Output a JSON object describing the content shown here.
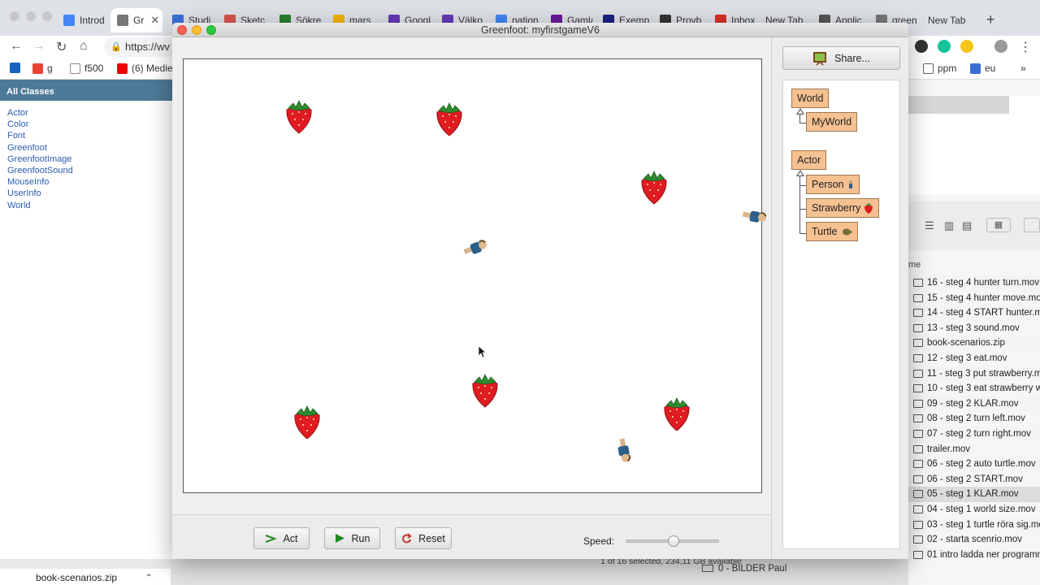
{
  "browser": {
    "tabs": [
      {
        "label": "Introd",
        "color": "#4285f4"
      },
      {
        "label": "Gr",
        "color": "#777777",
        "active": true
      },
      {
        "label": "Studi",
        "color": "#3b6fd6"
      },
      {
        "label": "Sketc",
        "color": "#d9534f"
      },
      {
        "label": "Sökre",
        "color": "#2e7d32"
      },
      {
        "label": "mars",
        "color": "#f4b400"
      },
      {
        "label": "Googl",
        "color": "#673ab7"
      },
      {
        "label": "Välko",
        "color": "#673ab7"
      },
      {
        "label": "nation",
        "color": "#4285f4"
      },
      {
        "label": "Gamla",
        "color": "#6a1b9a"
      },
      {
        "label": "Exemp",
        "color": "#1a237e"
      },
      {
        "label": "Provb",
        "color": "#333333"
      },
      {
        "label": "Inbox",
        "color": "#d93025"
      },
      {
        "label": "New Tab",
        "color": "#ffffff"
      },
      {
        "label": "Applic",
        "color": "#555555"
      },
      {
        "label": "green",
        "color": "#777777"
      },
      {
        "label": "New Tab",
        "color": "#ffffff"
      }
    ],
    "close_glyph": "✕",
    "new_tab_glyph": "+",
    "url": "https://wv",
    "bookmarks": [
      {
        "label": "g"
      },
      {
        "label": "f500"
      },
      {
        "label": "(6) Medie"
      },
      {
        "label": "ppm"
      },
      {
        "label": "eu"
      }
    ],
    "more_glyph": "»"
  },
  "javadoc": {
    "header": "All Classes",
    "classes": [
      "Actor",
      "Color",
      "Font",
      "Greenfoot",
      "GreenfootImage",
      "GreenfootSound",
      "MouseInfo",
      "UserInfo",
      "World"
    ]
  },
  "finder": {
    "column_header": "me",
    "files": [
      "16 - steg 4 hunter turn.mov",
      "15 - steg 4 hunter move.mov",
      "14 - steg 4 START hunter.mov",
      "13 - steg 3 sound.mov",
      "book-scenarios.zip",
      "12 - steg 3 eat.mov",
      "11 - steg 3 put strawberry.mov",
      "10 - steg 3 eat strawberry w",
      "09 - steg 2 KLAR.mov",
      "08 - steg 2 turn left.mov",
      "07 - steg 2 turn right.mov",
      "trailer.mov",
      "06 - steg 2 auto turtle.mov",
      "06 - steg 2 START.mov",
      "05 - steg 1 KLAR.mov",
      "04 - steg 1  world size.mov",
      "03 - steg 1 turtle röra sig.mov",
      "02 - starta scenrio.mov",
      "01 intro ladda ner programm"
    ],
    "selected_index": 14,
    "status": "1 of 16 selected, 234,11 GB available",
    "bottom_folder": "0 - BILDER Paul"
  },
  "download": {
    "filename": "book-scenarios.zip"
  },
  "greenfoot": {
    "title": "Greenfoot: myfirstgameV6",
    "buttons": {
      "act": "Act",
      "run": "Run",
      "reset": "Reset",
      "share": "Share..."
    },
    "speed_label": "Speed:",
    "speed_value": 0.5,
    "classes": {
      "world": "World",
      "myworld": "MyWorld",
      "actor": "Actor",
      "person": "Person",
      "strawberry": "Strawberry",
      "turtle": "Turtle"
    },
    "colors": {
      "class_box": "#f6c191",
      "strawberry": "#e01b22",
      "leaf": "#2e8b2e"
    }
  }
}
